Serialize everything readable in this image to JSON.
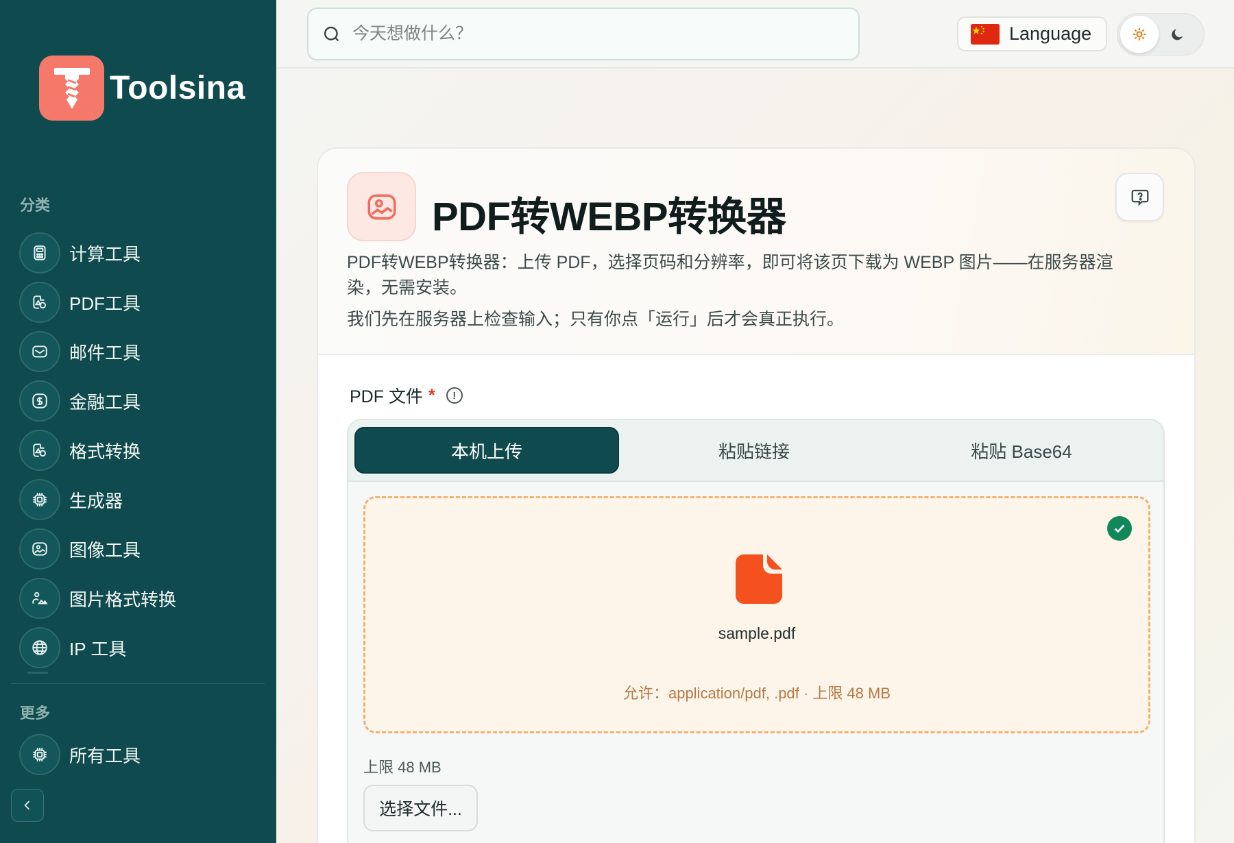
{
  "brand": {
    "name": "Toolsina",
    "color": "#f4796b"
  },
  "sidebar": {
    "bg_color": "#0f4a4e",
    "categories_label": "分类",
    "items": [
      {
        "label": "计算工具",
        "icon": "calculator-icon"
      },
      {
        "label": "PDF工具",
        "icon": "shapes-icon"
      },
      {
        "label": "邮件工具",
        "icon": "mail-icon"
      },
      {
        "label": "金融工具",
        "icon": "dollar-icon"
      },
      {
        "label": "格式转换",
        "icon": "shapes-icon"
      },
      {
        "label": "生成器",
        "icon": "chip-icon"
      },
      {
        "label": "图像工具",
        "icon": "image-icon"
      },
      {
        "label": "图片格式转换",
        "icon": "image-person-icon"
      },
      {
        "label": "IP 工具",
        "icon": "globe-icon"
      }
    ],
    "more_label": "更多",
    "more_items": [
      {
        "label": "所有工具",
        "icon": "chip-icon"
      }
    ]
  },
  "topbar": {
    "search_placeholder": "今天想做什么？",
    "language_label": "Language",
    "theme": {
      "active": "light"
    }
  },
  "tool": {
    "title": "PDF转WEBP转换器",
    "description": "PDF转WEBP转换器：上传 PDF，选择页码和分辨率，即可将该页下载为 WEBP 图片——在服务器渲染，无需安装。",
    "note": "我们先在服务器上检查输入；只有你点「运行」后才会真正执行。"
  },
  "field": {
    "label": "PDF 文件",
    "required_mark": "*",
    "tabs": [
      "本机上传",
      "粘贴链接",
      "粘贴 Base64"
    ],
    "active_tab": 0,
    "file_name": "sample.pdf",
    "allowed_text": "允许：application/pdf, .pdf · 上限 48 MB",
    "limit_text": "上限 48 MB",
    "choose_button": "选择文件..."
  },
  "colors": {
    "accent": "#0f4a4e",
    "file_icon": "#f4511e",
    "success": "#12885a",
    "dashed_border": "#f4b06e"
  }
}
